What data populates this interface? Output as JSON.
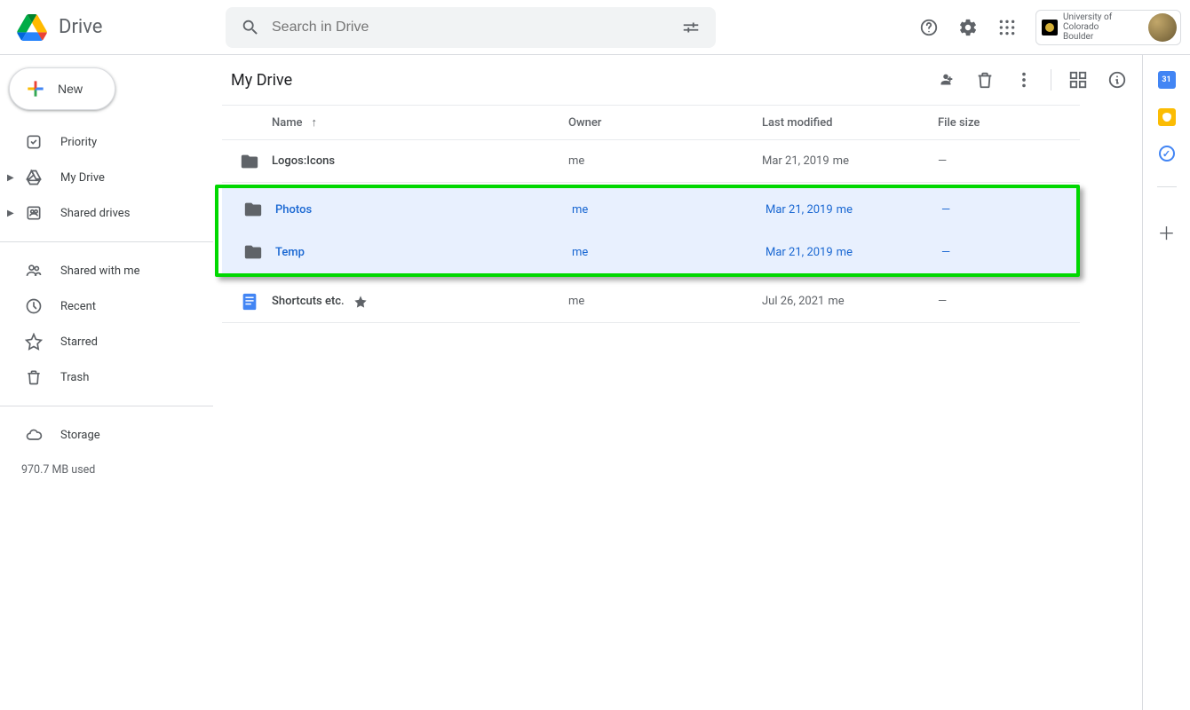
{
  "brand": "Drive",
  "search": {
    "placeholder": "Search in Drive"
  },
  "org": {
    "name": "University of Colorado\nBoulder"
  },
  "new_button": "New",
  "sidebar": {
    "priority": "Priority",
    "my_drive": "My Drive",
    "shared_drives": "Shared drives",
    "shared_with_me": "Shared with me",
    "recent": "Recent",
    "starred": "Starred",
    "trash": "Trash",
    "storage": "Storage",
    "storage_used": "970.7 MB used"
  },
  "breadcrumb": "My Drive",
  "columns": {
    "name": "Name",
    "owner": "Owner",
    "modified": "Last modified",
    "size": "File size"
  },
  "rows": [
    {
      "icon": "folder",
      "name": "Logos:Icons",
      "owner": "me",
      "modified": "Mar 21, 2019",
      "modified_by": "me",
      "size": "—",
      "selected": false,
      "starred": false
    },
    {
      "icon": "folder",
      "name": "Photos",
      "owner": "me",
      "modified": "Mar 21, 2019",
      "modified_by": "me",
      "size": "—",
      "selected": true,
      "starred": false
    },
    {
      "icon": "folder",
      "name": "Temp",
      "owner": "me",
      "modified": "Mar 21, 2019",
      "modified_by": "me",
      "size": "—",
      "selected": true,
      "starred": false
    },
    {
      "icon": "doc",
      "name": "Shortcuts etc.",
      "owner": "me",
      "modified": "Jul 26, 2021",
      "modified_by": "me",
      "size": "—",
      "selected": false,
      "starred": true
    }
  ]
}
